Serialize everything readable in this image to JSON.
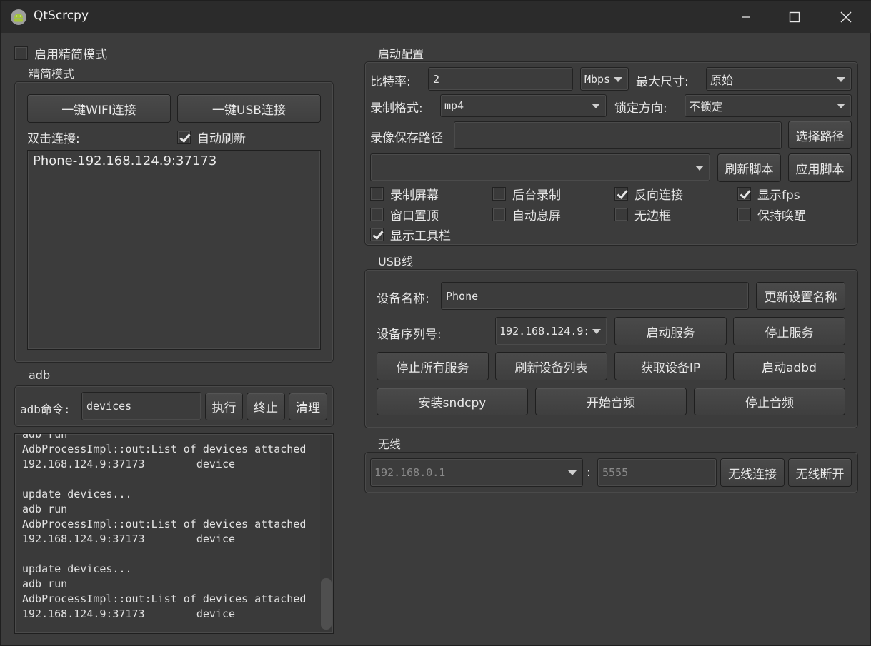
{
  "window": {
    "title": "QtScrcpy",
    "icon": "android-icon"
  },
  "simple": {
    "enable_label": "启用精简模式",
    "enable_checked": false,
    "group_label": "精简模式",
    "wifi_btn": "一键WIFI连接",
    "usb_btn": "一键USB连接",
    "dblclick_label": "双击连接:",
    "auto_refresh_label": "自动刷新",
    "auto_refresh_checked": true,
    "devices": [
      "Phone-192.168.124.9:37173"
    ]
  },
  "adb": {
    "group_label": "adb",
    "cmd_label": "adb命令:",
    "cmd_value": "devices",
    "exec_btn": "执行",
    "stop_btn": "终止",
    "clear_btn": "清理",
    "log": [
      "adb run",
      "AdbProcessImpl::out:List of devices attached",
      "192.168.124.9:37173        device",
      "",
      "update devices...",
      "adb run",
      "AdbProcessImpl::out:List of devices attached",
      "192.168.124.9:37173        device",
      "",
      "update devices...",
      "adb run",
      "AdbProcessImpl::out:List of devices attached",
      "192.168.124.9:37173        device"
    ]
  },
  "config": {
    "group_label": "启动配置",
    "bitrate_label": "比特率:",
    "bitrate_value": "2",
    "bitrate_unit": "Mbps",
    "maxsize_label": "最大尺寸:",
    "maxsize_value": "原始",
    "record_format_label": "录制格式:",
    "record_format_value": "mp4",
    "lock_label": "锁定方向:",
    "lock_value": "不锁定",
    "record_path_label": "录像保存路径",
    "record_path_value": "",
    "select_path_btn": "选择路径",
    "script_value": "",
    "refresh_script_btn": "刷新脚本",
    "apply_script_btn": "应用脚本",
    "options": [
      {
        "label": "录制屏幕",
        "checked": false
      },
      {
        "label": "后台录制",
        "checked": false
      },
      {
        "label": "反向连接",
        "checked": true
      },
      {
        "label": "显示fps",
        "checked": true
      },
      {
        "label": "窗口置顶",
        "checked": false
      },
      {
        "label": "自动息屏",
        "checked": false
      },
      {
        "label": "无边框",
        "checked": false
      },
      {
        "label": "保持唤醒",
        "checked": false
      },
      {
        "label": "显示工具栏",
        "checked": true
      }
    ]
  },
  "usb": {
    "group_label": "USB线",
    "device_name_label": "设备名称:",
    "device_name_value": "Phone",
    "update_name_btn": "更新设置名称",
    "serial_label": "设备序列号:",
    "serial_value": "192.168.124.9:",
    "start_service_btn": "启动服务",
    "stop_service_btn": "停止服务",
    "stop_all_btn": "停止所有服务",
    "refresh_devices_btn": "刷新设备列表",
    "get_ip_btn": "获取设备IP",
    "start_adbd_btn": "启动adbd",
    "install_sndcpy_btn": "安装sndcpy",
    "start_audio_btn": "开始音频",
    "stop_audio_btn": "停止音频"
  },
  "wireless": {
    "group_label": "无线",
    "ip_placeholder": "192.168.0.1",
    "colon": ":",
    "port_placeholder": "5555",
    "connect_btn": "无线连接",
    "disconnect_btn": "无线断开"
  }
}
